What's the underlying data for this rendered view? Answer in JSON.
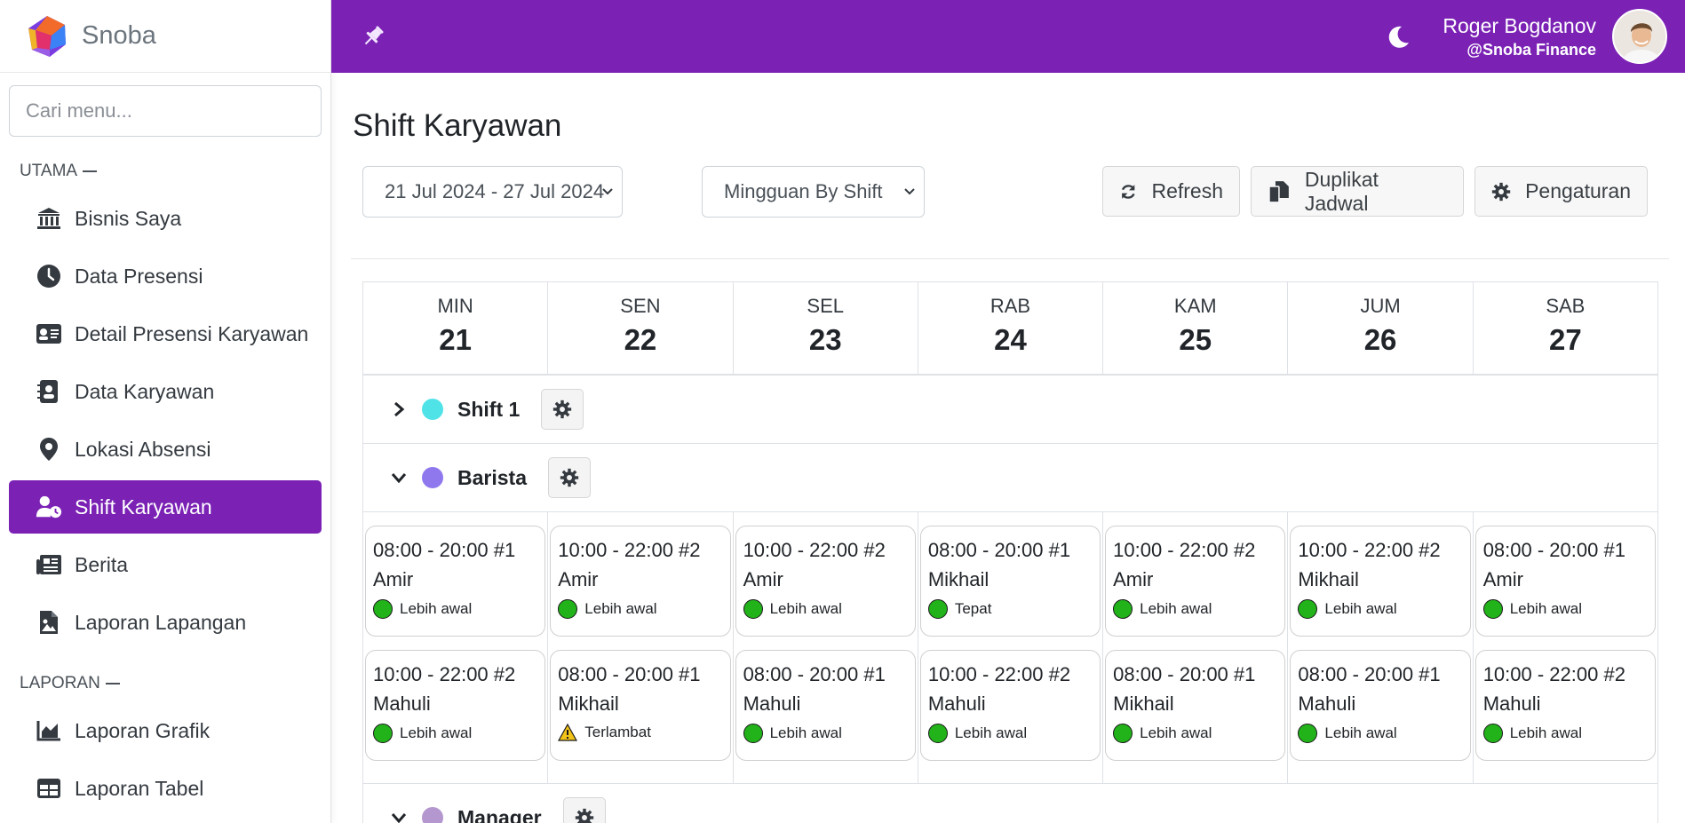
{
  "brand": {
    "name": "Snoba"
  },
  "search": {
    "placeholder": "Cari menu..."
  },
  "sidebar": {
    "sections": [
      {
        "heading": "UTAMA",
        "items": [
          {
            "label": "Bisnis Saya",
            "icon": "bank-icon",
            "active": false
          },
          {
            "label": "Data Presensi",
            "icon": "clock-icon",
            "active": false
          },
          {
            "label": "Detail Presensi Karyawan",
            "icon": "id-card-icon",
            "active": false
          },
          {
            "label": "Data Karyawan",
            "icon": "address-book-icon",
            "active": false
          },
          {
            "label": "Lokasi Absensi",
            "icon": "location-pin-icon",
            "active": false
          },
          {
            "label": "Shift Karyawan",
            "icon": "user-clock-icon",
            "active": true
          },
          {
            "label": "Berita",
            "icon": "newspaper-icon",
            "active": false
          },
          {
            "label": "Laporan Lapangan",
            "icon": "file-image-icon",
            "active": false
          }
        ]
      },
      {
        "heading": "LAPORAN",
        "items": [
          {
            "label": "Laporan Grafik",
            "icon": "area-chart-icon",
            "active": false
          },
          {
            "label": "Laporan Tabel",
            "icon": "table-icon",
            "active": false
          }
        ]
      }
    ]
  },
  "topbar": {
    "user_name": "Roger Bogdanov",
    "user_org": "@Snoba Finance",
    "accent": "#7b22b5"
  },
  "page": {
    "title": "Shift Karyawan",
    "date_range": "21 Jul 2024 - 27 Jul 2024",
    "view_mode": "Mingguan By Shift",
    "buttons": {
      "refresh": "Refresh",
      "duplicate": "Duplikat Jadwal",
      "settings": "Pengaturan"
    }
  },
  "calendar": {
    "days": [
      {
        "name": "MIN",
        "num": "21"
      },
      {
        "name": "SEN",
        "num": "22"
      },
      {
        "name": "SEL",
        "num": "23"
      },
      {
        "name": "RAB",
        "num": "24"
      },
      {
        "name": "KAM",
        "num": "25"
      },
      {
        "name": "JUM",
        "num": "26"
      },
      {
        "name": "SAB",
        "num": "27"
      }
    ],
    "groups": [
      {
        "name": "Shift 1",
        "color": "#4fe3e8",
        "expanded": false,
        "rows": []
      },
      {
        "name": "Barista",
        "color": "#8f78ee",
        "expanded": true,
        "rows": [
          [
            {
              "time": "08:00 - 20:00 #1",
              "employee": "Amir",
              "status": "Lebih awal",
              "status_type": "ok"
            },
            {
              "time": "10:00 - 22:00 #2",
              "employee": "Amir",
              "status": "Lebih awal",
              "status_type": "ok"
            },
            {
              "time": "10:00 - 22:00 #2",
              "employee": "Amir",
              "status": "Lebih awal",
              "status_type": "ok"
            },
            {
              "time": "08:00 - 20:00 #1",
              "employee": "Mikhail",
              "status": "Tepat",
              "status_type": "ok"
            },
            {
              "time": "10:00 - 22:00 #2",
              "employee": "Amir",
              "status": "Lebih awal",
              "status_type": "ok"
            },
            {
              "time": "10:00 - 22:00 #2",
              "employee": "Mikhail",
              "status": "Lebih awal",
              "status_type": "ok"
            },
            {
              "time": "08:00 - 20:00 #1",
              "employee": "Amir",
              "status": "Lebih awal",
              "status_type": "ok"
            }
          ],
          [
            {
              "time": "10:00 - 22:00 #2",
              "employee": "Mahuli",
              "status": "Lebih awal",
              "status_type": "ok"
            },
            {
              "time": "08:00 - 20:00 #1",
              "employee": "Mikhail",
              "status": "Terlambat",
              "status_type": "warn"
            },
            {
              "time": "08:00 - 20:00 #1",
              "employee": "Mahuli",
              "status": "Lebih awal",
              "status_type": "ok"
            },
            {
              "time": "10:00 - 22:00 #2",
              "employee": "Mahuli",
              "status": "Lebih awal",
              "status_type": "ok"
            },
            {
              "time": "08:00 - 20:00 #1",
              "employee": "Mikhail",
              "status": "Lebih awal",
              "status_type": "ok"
            },
            {
              "time": "08:00 - 20:00 #1",
              "employee": "Mahuli",
              "status": "Lebih awal",
              "status_type": "ok"
            },
            {
              "time": "10:00 - 22:00 #2",
              "employee": "Mahuli",
              "status": "Lebih awal",
              "status_type": "ok"
            }
          ]
        ]
      },
      {
        "name": "Manager",
        "color": "#b497cf",
        "expanded": true,
        "rows": []
      }
    ]
  }
}
